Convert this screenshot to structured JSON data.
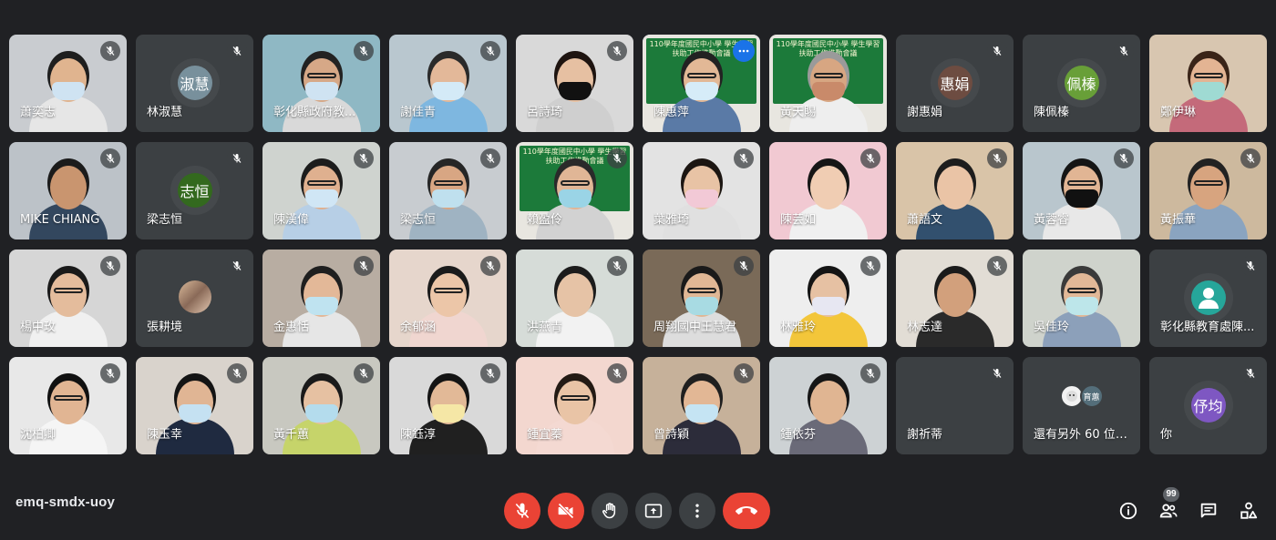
{
  "meeting_code": "emq-smdx-uoy",
  "participants_badge": "99",
  "board_text": "110學年度國民中小學 學生學習扶助工作推動會議",
  "colors": {
    "background": "#202124",
    "tile": "#3c4043",
    "danger": "#ea4335",
    "active_border": "#8ab4f8"
  },
  "tiles": [
    {
      "name": "蕭奕志",
      "type": "video",
      "bg": "#c9ccd0",
      "skin": "#e0b48f",
      "hair": "#1e1e1e",
      "shirt": "#e6e6e6",
      "mask": "#cfe3f2",
      "glasses": false,
      "muted": true
    },
    {
      "name": "林淑慧",
      "type": "avatar",
      "initial": "淑慧",
      "color": "#78909c",
      "muted": true
    },
    {
      "name": "彰化縣政府教...",
      "type": "video",
      "bg": "#8fb8c4",
      "skin": "#d6a887",
      "hair": "#222",
      "shirt": "#d9d9d9",
      "mask": "#cfe3f2",
      "glasses": true,
      "muted": true
    },
    {
      "name": "謝佳青",
      "type": "video",
      "bg": "#b9c7cf",
      "skin": "#e3b899",
      "hair": "#2a2a2a",
      "shirt": "#7eb7e0",
      "mask": "#d4eaf7",
      "glasses": false,
      "muted": true
    },
    {
      "name": "呂詩琦",
      "type": "video",
      "bg": "#d9d9d9",
      "skin": "#e6c0a2",
      "hair": "#1e1410",
      "shirt": "#cfcfcf",
      "mask": "#111",
      "glasses": false,
      "muted": true
    },
    {
      "name": "陳惠萍",
      "type": "board",
      "skin": "#e2b896",
      "hair": "#222",
      "shirt": "#5a7aa6",
      "mask": "#d6ecf8",
      "glasses": true,
      "muted": false,
      "active": true
    },
    {
      "name": "黃天賜",
      "type": "board",
      "skin": "#d7a682",
      "hair": "#9a9a9a",
      "shirt": "#eeeeee",
      "mask": "#c98a6a",
      "glasses": true,
      "muted": false
    },
    {
      "name": "謝惠娟",
      "type": "avatar",
      "initial": "惠娟",
      "color": "#6d4c41",
      "muted": true
    },
    {
      "name": "陳佩榛",
      "type": "avatar",
      "initial": "佩榛",
      "color": "#689f38",
      "muted": true
    },
    {
      "name": "鄭伊琳",
      "type": "video",
      "bg": "#d8c6b0",
      "skin": "#e3b493",
      "hair": "#3a2418",
      "shirt": "#c46a7a",
      "mask": "#9fdad3",
      "glasses": true,
      "muted": false
    },
    {
      "name": "MIKE CHIANG",
      "type": "video",
      "bg": "#bcc2c8",
      "skin": "#c9956f",
      "hair": "#1b1b1b",
      "shirt": "#33475e",
      "mask": "",
      "glasses": false,
      "muted": true
    },
    {
      "name": "梁志恒",
      "type": "avatar",
      "initial": "志恒",
      "color": "#33691e",
      "muted": true
    },
    {
      "name": "陳漢偉",
      "type": "video",
      "bg": "#cfd3cf",
      "skin": "#dfb08f",
      "hair": "#1c1c1c",
      "shirt": "#b7cfe6",
      "mask": "#d0e6f5",
      "glasses": true,
      "muted": true
    },
    {
      "name": "梁志恒",
      "type": "video",
      "bg": "#c8ccd0",
      "skin": "#d8a683",
      "hair": "#262626",
      "shirt": "#9fb3c2",
      "mask": "#bfe0ee",
      "glasses": true,
      "muted": true
    },
    {
      "name": "賴盈伶",
      "type": "board",
      "skin": "#e0b696",
      "hair": "#2a2a2a",
      "shirt": "#d2d2d2",
      "mask": "#9ad4e6",
      "glasses": true,
      "muted": true
    },
    {
      "name": "葉雅琦",
      "type": "video",
      "bg": "#e3e3e3",
      "skin": "#e8c3a5",
      "hair": "#1c1612",
      "shirt": "#e0e0e0",
      "mask": "#f2c9d6",
      "glasses": false,
      "muted": true
    },
    {
      "name": "陳芸如",
      "type": "video",
      "bg": "#f1c9d2",
      "skin": "#f0cdb3",
      "hair": "#161616",
      "shirt": "#f0f0f0",
      "mask": "",
      "glasses": false,
      "muted": true
    },
    {
      "name": "蕭語文",
      "type": "video",
      "bg": "#d9c4a8",
      "skin": "#eac4a6",
      "hair": "#1d1d1d",
      "shirt": "#32506e",
      "mask": "",
      "glasses": false,
      "muted": true
    },
    {
      "name": "黃蓉睿",
      "type": "video",
      "bg": "#b9c6cd",
      "skin": "#e1b594",
      "hair": "#151515",
      "shirt": "#e8e8e8",
      "mask": "#111",
      "glasses": true,
      "muted": true
    },
    {
      "name": "黃振華",
      "type": "video",
      "bg": "#cdb99e",
      "skin": "#d7a47f",
      "hair": "#222",
      "shirt": "#8aa4c0",
      "mask": "",
      "glasses": true,
      "muted": true
    },
    {
      "name": "楊中玫",
      "type": "video",
      "bg": "#d6d6d6",
      "skin": "#e4bc9c",
      "hair": "#1a1a1a",
      "shirt": "#f0f0f0",
      "mask": "",
      "glasses": true,
      "muted": true
    },
    {
      "name": "張耕境",
      "type": "smallpic",
      "muted": true
    },
    {
      "name": "金惠恬",
      "type": "video",
      "bg": "#b8ada2",
      "skin": "#e3b898",
      "hair": "#1f1f1f",
      "shirt": "#e6e6e6",
      "mask": "#bfe3f0",
      "glasses": false,
      "muted": true
    },
    {
      "name": "余郁涵",
      "type": "video",
      "bg": "#e6d6cc",
      "skin": "#ecc6a8",
      "hair": "#1b1b1b",
      "shirt": "#f0d6d0",
      "mask": "",
      "glasses": true,
      "muted": true
    },
    {
      "name": "洪燕青",
      "type": "video",
      "bg": "#d6dcd8",
      "skin": "#e6c3a6",
      "hair": "#1c1c1c",
      "shirt": "#f2f2f2",
      "mask": "",
      "glasses": false,
      "muted": true
    },
    {
      "name": "周翔國中王慧君",
      "type": "video",
      "bg": "#7a6a58",
      "skin": "#e0b795",
      "hair": "#1a1a1a",
      "shirt": "#dddddd",
      "mask": "#a8dbe3",
      "glasses": true,
      "muted": true
    },
    {
      "name": "林雅玲",
      "type": "video",
      "bg": "#eeeeee",
      "skin": "#e6c1a3",
      "hair": "#141414",
      "shirt": "#f3c63a",
      "mask": "#e7e7f2",
      "glasses": false,
      "muted": true
    },
    {
      "name": "林志達",
      "type": "video",
      "bg": "#e2ddd5",
      "skin": "#d2a07c",
      "hair": "#1b1b1b",
      "shirt": "#2a2a2a",
      "mask": "",
      "glasses": false,
      "muted": true
    },
    {
      "name": "吳佳玲",
      "type": "video",
      "bg": "#cfd3cc",
      "skin": "#e2b897",
      "hair": "#3a3a3a",
      "shirt": "#8ca0ba",
      "mask": "#bde6ea",
      "glasses": true,
      "muted": false
    },
    {
      "name": "彰化縣教育處陳...",
      "type": "avatar",
      "initial": "",
      "person": true,
      "color": "#26a69a",
      "muted": true
    },
    {
      "name": "沈柏卿",
      "type": "video",
      "bg": "#e8e8e8",
      "skin": "#e1b593",
      "hair": "#111",
      "shirt": "#f5f5f5",
      "mask": "",
      "glasses": true,
      "muted": true
    },
    {
      "name": "陳玉幸",
      "type": "video",
      "bg": "#d9d3cc",
      "skin": "#e0b594",
      "hair": "#141414",
      "shirt": "#1f2a40",
      "mask": "#c5e1f2",
      "glasses": false,
      "muted": true
    },
    {
      "name": "黃千蕙",
      "type": "video",
      "bg": "#c8c8c0",
      "skin": "#e6c1a2",
      "hair": "#1a1a1a",
      "shirt": "#c6d46a",
      "mask": "#b4dced",
      "glasses": false,
      "muted": true
    },
    {
      "name": "陳鈺淳",
      "type": "video",
      "bg": "#d9d9d9",
      "skin": "#e2b997",
      "hair": "#141414",
      "shirt": "#202020",
      "mask": "#f5e7a6",
      "glasses": false,
      "muted": true
    },
    {
      "name": "鍾宜蓁",
      "type": "video",
      "bg": "#f3d7cf",
      "skin": "#e9c4a6",
      "hair": "#231a14",
      "shirt": "#f4d9d2",
      "mask": "",
      "glasses": true,
      "muted": true
    },
    {
      "name": "曾詩穎",
      "type": "video",
      "bg": "#c6b19a",
      "skin": "#e2b795",
      "hair": "#1f1f1f",
      "shirt": "#2c2c3a",
      "mask": "#c5e4f3",
      "glasses": false,
      "muted": true
    },
    {
      "name": "鍾依芬",
      "type": "video",
      "bg": "#cdd2d4",
      "skin": "#e0b592",
      "hair": "#161616",
      "shirt": "#6a6a78",
      "mask": "",
      "glasses": false,
      "muted": true
    },
    {
      "name": "謝祈蒂",
      "type": "blank",
      "muted": true
    },
    {
      "name": "還有另外 60 位使用者",
      "type": "others",
      "others_initial": "育蕙",
      "muted": false
    },
    {
      "name": "你",
      "type": "avatar",
      "initial": "伃均",
      "color": "#7e57c2",
      "muted": true
    }
  ],
  "controls": [
    {
      "name": "mic-off-button",
      "icon": "mic-off-icon",
      "style": "red"
    },
    {
      "name": "camera-off-button",
      "icon": "camera-off-icon",
      "style": "red"
    },
    {
      "name": "raise-hand-button",
      "icon": "hand-icon",
      "style": "dark"
    },
    {
      "name": "present-button",
      "icon": "present-icon",
      "style": "dark"
    },
    {
      "name": "more-options-button",
      "icon": "more-vert-icon",
      "style": "dark"
    },
    {
      "name": "leave-call-button",
      "icon": "call-end-icon",
      "style": "end"
    }
  ],
  "right_tools": [
    {
      "name": "meeting-details-button",
      "icon": "info-icon"
    },
    {
      "name": "people-button",
      "icon": "people-icon",
      "badge": true
    },
    {
      "name": "chat-button",
      "icon": "chat-icon"
    },
    {
      "name": "activities-button",
      "icon": "activities-icon"
    }
  ]
}
